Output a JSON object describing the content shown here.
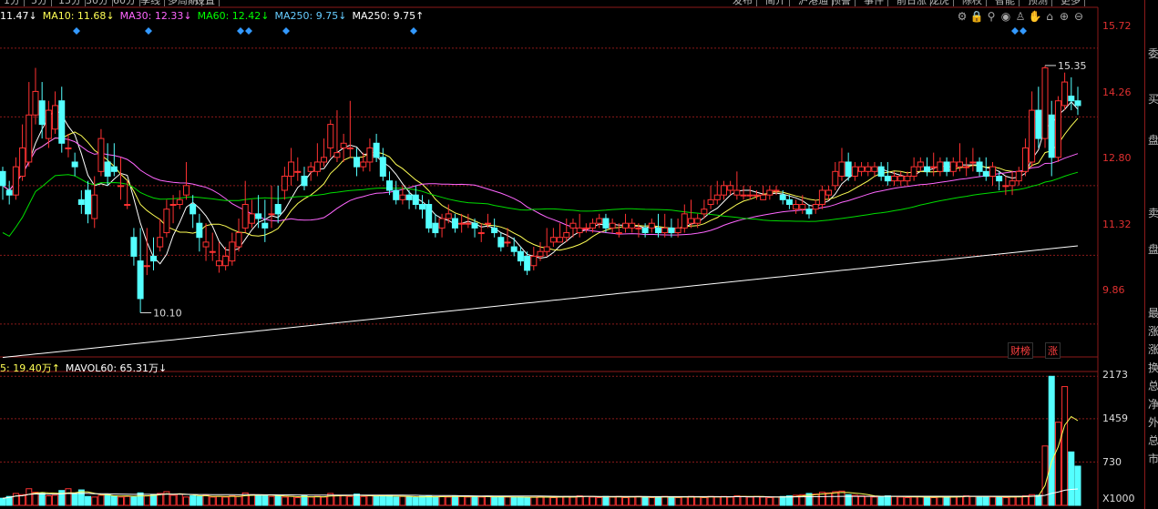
{
  "top_tabs": [
    "1分",
    "5分",
    "15分",
    "30分",
    "60分",
    "季线",
    "多周期",
    "设置",
    "发布",
    "简介",
    "沪港通",
    "预警",
    "事件",
    "前日涨",
    "龙虎",
    "除权",
    "智能",
    "预测",
    "更多"
  ],
  "legend": [
    {
      "text": "11.47↓",
      "color": "#ffffff"
    },
    {
      "text": "MA10: 11.68↓",
      "color": "#ffff55"
    },
    {
      "text": "MA30: 12.33↓",
      "color": "#ff66ff"
    },
    {
      "text": "MA60: 12.42↓",
      "color": "#00ff00"
    },
    {
      "text": "MA250: 9.75↓",
      "color": "#66ccff"
    },
    {
      "text": "MA250: 9.75↑",
      "color": "#ffffff"
    }
  ],
  "volume_legend": [
    {
      "text": "5: 19.40万↑",
      "color": "#ffff55"
    },
    {
      "text": "MAVOL60: 65.31万↓",
      "color": "#ffffff"
    }
  ],
  "toolbar_icons": [
    "settings-icon",
    "lock-icon",
    "filter-icon",
    "eye-icon",
    "cup-icon",
    "hand-icon",
    "home-icon",
    "zoom-in-icon",
    "zoom-out-icon"
  ],
  "side_panel": [
    "委",
    "买",
    "盘",
    "卖",
    "盘",
    "最",
    "涨",
    "涨",
    "换",
    "总",
    "净",
    "外",
    "总",
    "市"
  ],
  "tags": {
    "max_price": "15.35",
    "min_price": "10.10",
    "caibang": "财榜",
    "zhang": "涨",
    "volume_unit": "X1000"
  },
  "colors": {
    "up": "#ff3232",
    "down": "#54ffff",
    "ma5": "#ffffff",
    "ma10": "#ffff55",
    "ma30": "#ff66ff",
    "ma60": "#00dd00",
    "ma250": "#ffffff",
    "grid": "#8b1a1a"
  },
  "chart_data": {
    "type": "candlestick",
    "price_axis": {
      "ticks": [
        "15.72",
        "14.26",
        "12.80",
        "11.32",
        "9.86"
      ],
      "ylim": [
        9.2,
        16.2
      ]
    },
    "volume_axis": {
      "ticks": [
        "2173",
        "1459",
        "730"
      ],
      "unit": "X1000",
      "ylim": [
        0,
        2300
      ]
    },
    "annotations": [
      {
        "label": "15.35",
        "type": "high"
      },
      {
        "label": "10.10",
        "type": "low"
      }
    ],
    "candles": [
      [
        13.1,
        12.8,
        13.2,
        12.5
      ],
      [
        12.7,
        12.6,
        12.9,
        12.4
      ],
      [
        12.6,
        13.2,
        13.4,
        12.5
      ],
      [
        13.0,
        13.6,
        14.1,
        12.9
      ],
      [
        13.3,
        14.3,
        15.0,
        13.2
      ],
      [
        14.3,
        14.8,
        15.3,
        14.1
      ],
      [
        14.6,
        14.1,
        15.0,
        13.8
      ],
      [
        13.8,
        14.4,
        14.6,
        13.6
      ],
      [
        14.0,
        14.5,
        14.8,
        13.9
      ],
      [
        14.6,
        13.7,
        14.9,
        13.5
      ],
      [
        13.6,
        13.6,
        13.9,
        13.4
      ],
      [
        13.3,
        13.2,
        13.5,
        13.0
      ],
      [
        12.5,
        12.4,
        12.7,
        12.2
      ],
      [
        12.7,
        12.2,
        12.9,
        12.0
      ],
      [
        12.1,
        12.6,
        13.0,
        11.9
      ],
      [
        13.1,
        13.8,
        14.0,
        13.0
      ],
      [
        13.3,
        13.0,
        13.7,
        12.8
      ],
      [
        13.2,
        13.1,
        13.7,
        13.0
      ],
      [
        12.8,
        12.8,
        13.4,
        12.5
      ],
      [
        12.4,
        12.4,
        12.9,
        12.3
      ],
      [
        11.7,
        11.3,
        11.9,
        11.1
      ],
      [
        11.2,
        10.4,
        11.9,
        10.1
      ],
      [
        11.1,
        11.1,
        11.9,
        10.9
      ],
      [
        11.3,
        11.2,
        11.7,
        11.0
      ],
      [
        11.5,
        11.7,
        12.1,
        11.4
      ],
      [
        11.8,
        12.3,
        12.5,
        11.7
      ],
      [
        12.4,
        12.4,
        12.6,
        12.0
      ],
      [
        12.4,
        12.5,
        12.7,
        12.3
      ],
      [
        12.6,
        12.8,
        13.3,
        12.5
      ],
      [
        12.4,
        12.2,
        12.6,
        11.9
      ],
      [
        12.0,
        11.7,
        12.2,
        11.4
      ],
      [
        11.5,
        11.6,
        12.0,
        11.2
      ],
      [
        11.4,
        11.4,
        11.8,
        11.2
      ],
      [
        11.1,
        11.2,
        11.6,
        10.95
      ],
      [
        11.1,
        11.3,
        11.5,
        11.0
      ],
      [
        11.2,
        11.6,
        11.8,
        11.1
      ],
      [
        11.5,
        11.8,
        12.1,
        11.4
      ],
      [
        11.9,
        12.4,
        12.9,
        11.8
      ],
      [
        12.0,
        12.2,
        12.5,
        11.9
      ],
      [
        12.2,
        12.1,
        12.6,
        11.9
      ],
      [
        12.0,
        11.9,
        12.5,
        11.6
      ],
      [
        12.2,
        12.2,
        12.8,
        11.9
      ],
      [
        12.4,
        12.2,
        12.8,
        12.0
      ],
      [
        12.7,
        13.0,
        13.2,
        12.5
      ],
      [
        13.0,
        13.3,
        13.6,
        12.8
      ],
      [
        13.1,
        13.1,
        13.4,
        12.9
      ],
      [
        13.0,
        12.8,
        13.2,
        12.7
      ],
      [
        13.1,
        13.2,
        13.3,
        12.9
      ],
      [
        13.1,
        13.3,
        13.7,
        13.0
      ],
      [
        13.3,
        13.4,
        13.8,
        13.2
      ],
      [
        13.6,
        14.1,
        14.2,
        13.4
      ],
      [
        13.4,
        13.5,
        14.4,
        13.3
      ],
      [
        13.6,
        13.7,
        13.9,
        13.3
      ],
      [
        13.6,
        13.6,
        14.6,
        13.4
      ],
      [
        13.4,
        13.2,
        13.6,
        13.0
      ],
      [
        13.2,
        13.3,
        13.5,
        13.1
      ],
      [
        13.3,
        13.6,
        13.8,
        13.1
      ],
      [
        13.7,
        13.4,
        13.9,
        13.3
      ],
      [
        13.4,
        13.0,
        13.6,
        12.9
      ],
      [
        12.9,
        12.7,
        13.1,
        12.6
      ],
      [
        12.7,
        12.5,
        12.9,
        12.4
      ],
      [
        12.5,
        12.6,
        12.8,
        12.4
      ],
      [
        12.6,
        12.5,
        12.7,
        12.3
      ],
      [
        12.6,
        12.4,
        12.8,
        12.3
      ],
      [
        12.4,
        12.3,
        12.6,
        12.1
      ],
      [
        12.4,
        11.9,
        12.5,
        11.8
      ],
      [
        12.0,
        11.8,
        12.2,
        11.7
      ],
      [
        11.9,
        12.1,
        12.2,
        11.7
      ],
      [
        12.1,
        12.2,
        12.4,
        12.0
      ],
      [
        12.1,
        11.9,
        12.2,
        11.8
      ],
      [
        12.0,
        12.0,
        12.2,
        11.8
      ],
      [
        12.0,
        12.0,
        12.2,
        11.9
      ],
      [
        12.0,
        11.9,
        12.1,
        11.7
      ],
      [
        11.8,
        11.8,
        12.0,
        11.6
      ],
      [
        12.0,
        12.0,
        12.2,
        11.9
      ],
      [
        11.9,
        11.8,
        12.1,
        11.7
      ],
      [
        11.7,
        11.5,
        11.8,
        11.4
      ],
      [
        11.6,
        11.6,
        11.9,
        11.5
      ],
      [
        11.5,
        11.4,
        11.7,
        11.3
      ],
      [
        11.4,
        11.2,
        11.5,
        11.1
      ],
      [
        11.3,
        11.0,
        11.4,
        10.9
      ],
      [
        11.1,
        11.3,
        11.5,
        11.0
      ],
      [
        11.3,
        11.4,
        11.6,
        11.2
      ],
      [
        11.4,
        11.5,
        11.9,
        11.3
      ],
      [
        11.6,
        11.7,
        11.9,
        11.5
      ],
      [
        11.6,
        11.7,
        12.0,
        11.6
      ],
      [
        11.7,
        11.8,
        12.1,
        11.6
      ],
      [
        11.9,
        12.0,
        12.1,
        11.7
      ],
      [
        11.8,
        11.9,
        12.2,
        11.7
      ],
      [
        11.9,
        11.9,
        12.0,
        11.8
      ],
      [
        11.9,
        12.0,
        12.1,
        11.8
      ],
      [
        12.0,
        12.1,
        12.2,
        11.9
      ],
      [
        12.1,
        11.9,
        12.2,
        11.8
      ],
      [
        11.9,
        12.0,
        12.1,
        11.8
      ],
      [
        11.8,
        11.8,
        12.0,
        11.7
      ],
      [
        11.9,
        12.0,
        12.2,
        11.8
      ],
      [
        11.9,
        12.0,
        12.1,
        11.8
      ],
      [
        11.9,
        11.9,
        12.0,
        11.7
      ],
      [
        11.9,
        11.8,
        12.0,
        11.7
      ],
      [
        11.9,
        12.0,
        12.1,
        11.8
      ],
      [
        11.9,
        11.8,
        12.2,
        11.7
      ],
      [
        11.8,
        11.9,
        12.2,
        11.7
      ],
      [
        11.9,
        11.8,
        12.1,
        11.7
      ],
      [
        11.8,
        11.9,
        12.1,
        11.7
      ],
      [
        11.9,
        12.2,
        12.4,
        11.8
      ],
      [
        12.0,
        12.1,
        12.5,
        11.9
      ],
      [
        12.0,
        12.1,
        12.2,
        11.9
      ],
      [
        12.2,
        12.3,
        12.5,
        12.1
      ],
      [
        12.4,
        12.5,
        12.8,
        12.3
      ],
      [
        12.5,
        12.6,
        12.9,
        12.4
      ],
      [
        12.6,
        12.8,
        12.9,
        12.5
      ],
      [
        12.7,
        12.8,
        12.9,
        12.6
      ],
      [
        12.6,
        12.7,
        13.1,
        12.5
      ],
      [
        12.6,
        12.6,
        12.8,
        12.5
      ],
      [
        12.6,
        12.6,
        12.8,
        12.5
      ],
      [
        12.6,
        12.6,
        12.7,
        12.5
      ],
      [
        12.5,
        12.6,
        12.8,
        12.5
      ],
      [
        12.6,
        12.7,
        12.8,
        12.5
      ],
      [
        12.7,
        12.7,
        12.8,
        12.6
      ],
      [
        12.6,
        12.5,
        12.7,
        12.4
      ],
      [
        12.5,
        12.4,
        12.6,
        12.3
      ],
      [
        12.3,
        12.4,
        12.5,
        12.2
      ],
      [
        12.3,
        12.4,
        12.6,
        12.2
      ],
      [
        12.3,
        12.2,
        12.4,
        12.1
      ],
      [
        12.3,
        12.4,
        12.5,
        12.2
      ],
      [
        12.4,
        12.7,
        12.8,
        12.3
      ],
      [
        12.6,
        12.7,
        12.8,
        12.5
      ],
      [
        12.8,
        13.1,
        13.3,
        12.7
      ],
      [
        13.0,
        13.3,
        13.6,
        12.9
      ],
      [
        13.3,
        13.0,
        13.5,
        12.9
      ],
      [
        13.0,
        13.2,
        13.3,
        12.9
      ],
      [
        13.1,
        13.2,
        13.3,
        13.0
      ],
      [
        13.1,
        13.2,
        13.3,
        13.0
      ],
      [
        13.1,
        13.2,
        13.3,
        13.0
      ],
      [
        13.2,
        13.0,
        13.3,
        12.9
      ],
      [
        13.0,
        12.9,
        13.3,
        12.8
      ],
      [
        12.9,
        13.0,
        13.1,
        12.8
      ],
      [
        12.9,
        13.0,
        13.1,
        12.8
      ],
      [
        12.9,
        13.0,
        13.1,
        12.8
      ],
      [
        13.0,
        13.2,
        13.4,
        12.9
      ],
      [
        13.2,
        13.3,
        13.4,
        13.1
      ],
      [
        13.2,
        13.1,
        13.4,
        13.0
      ],
      [
        13.2,
        13.2,
        13.5,
        13.0
      ],
      [
        13.1,
        13.3,
        13.4,
        13.0
      ],
      [
        13.3,
        13.1,
        13.4,
        13.0
      ],
      [
        13.1,
        13.3,
        13.4,
        13.0
      ],
      [
        13.2,
        13.3,
        13.7,
        13.1
      ],
      [
        13.2,
        13.2,
        13.4,
        13.0
      ],
      [
        13.3,
        13.3,
        13.6,
        13.1
      ],
      [
        13.3,
        13.1,
        13.4,
        13.0
      ],
      [
        13.1,
        13.0,
        13.4,
        12.9
      ],
      [
        13.0,
        13.2,
        13.3,
        12.8
      ],
      [
        13.0,
        12.9,
        13.1,
        12.7
      ],
      [
        12.8,
        12.8,
        13.0,
        12.6
      ],
      [
        12.8,
        12.9,
        13.1,
        12.6
      ],
      [
        12.9,
        13.1,
        13.2,
        12.8
      ],
      [
        13.1,
        13.6,
        13.8,
        13.0
      ],
      [
        13.3,
        14.4,
        14.8,
        13.2
      ],
      [
        14.4,
        13.8,
        14.9,
        13.6
      ],
      [
        13.8,
        15.3,
        15.35,
        13.6
      ],
      [
        14.3,
        13.4,
        14.6,
        13.0
      ],
      [
        13.4,
        14.6,
        14.7,
        13.3
      ],
      [
        14.5,
        15.0,
        15.2,
        14.4
      ],
      [
        14.7,
        14.6,
        15.1,
        14.4
      ],
      [
        14.6,
        14.5,
        14.9,
        14.3
      ]
    ],
    "volume": [
      120,
      150,
      200,
      180,
      280,
      220,
      200,
      160,
      170,
      250,
      280,
      190,
      260,
      150,
      140,
      170,
      180,
      160,
      140,
      150,
      140,
      210,
      160,
      180,
      200,
      230,
      170,
      190,
      140,
      160,
      150,
      170,
      140,
      150,
      140,
      160,
      150,
      210,
      180,
      170,
      160,
      150,
      160,
      140,
      150,
      130,
      160,
      140,
      150,
      140,
      200,
      170,
      160,
      150,
      190,
      150,
      160,
      150,
      160,
      170,
      140,
      150,
      140,
      130,
      150,
      160,
      140,
      150,
      140,
      160,
      150,
      140,
      150,
      140,
      150,
      140,
      150,
      140,
      130,
      140,
      130,
      140,
      150,
      140,
      130,
      140,
      150,
      140,
      160,
      150,
      140,
      130,
      150,
      140,
      150,
      130,
      140,
      150,
      140,
      130,
      140,
      150,
      140,
      130,
      140,
      150,
      140,
      130,
      150,
      140,
      150,
      140,
      160,
      150,
      140,
      150,
      140,
      130,
      140,
      150,
      160,
      170,
      180,
      200,
      190,
      220,
      210,
      230,
      240,
      180,
      170,
      160,
      150,
      140,
      150,
      160,
      150,
      140,
      130,
      140,
      150,
      140,
      130,
      140,
      150,
      140,
      150,
      160,
      150,
      140,
      150,
      140,
      150,
      130,
      140,
      150,
      160,
      180,
      170,
      1000,
      2173,
      1400,
      2000,
      900,
      660
    ]
  }
}
